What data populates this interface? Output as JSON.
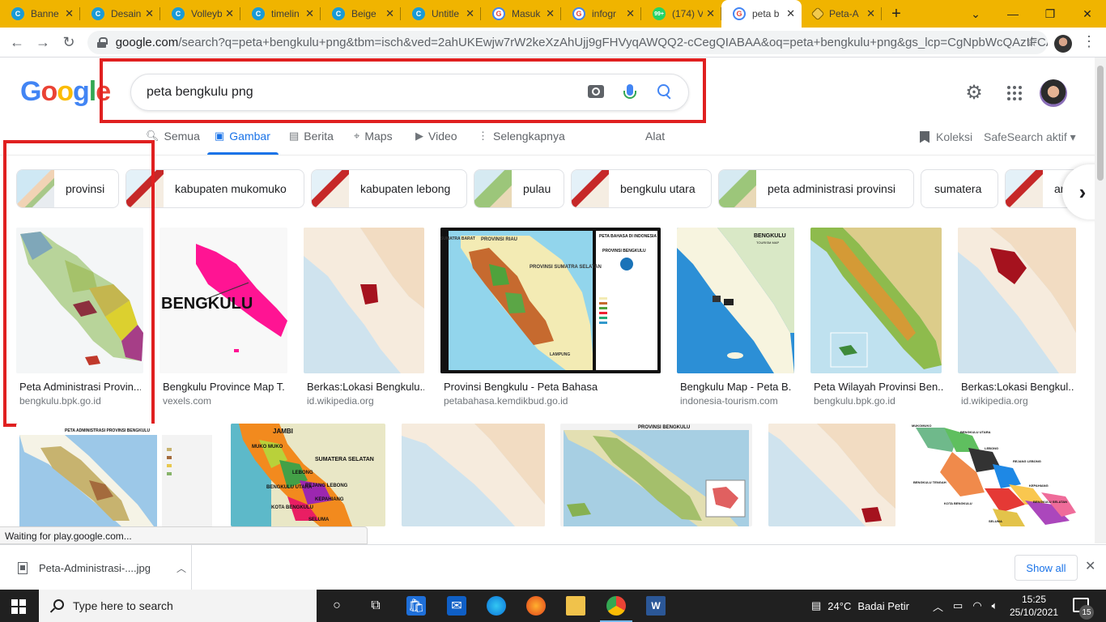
{
  "browser": {
    "tabs": [
      {
        "title": "Banne",
        "icon": "canva-icon"
      },
      {
        "title": "Desain",
        "icon": "canva-icon"
      },
      {
        "title": "Volleyb",
        "icon": "canva-icon"
      },
      {
        "title": "timelin",
        "icon": "canva-icon"
      },
      {
        "title": "Beige",
        "icon": "canva-icon"
      },
      {
        "title": "Untitle",
        "icon": "canva-icon"
      },
      {
        "title": "Masuk",
        "icon": "google-icon"
      },
      {
        "title": "infogr",
        "icon": "google-icon"
      },
      {
        "title": "(174) V",
        "icon": "whatsapp-icon"
      },
      {
        "title": "peta b",
        "icon": "google-icon",
        "active": true
      },
      {
        "title": "Peta-A",
        "icon": "map-icon"
      }
    ],
    "url_host": "google.com",
    "url_rest": "/search?q=peta+bengkulu+png&tbm=isch&ved=2ahUKEwjw7rW2keXzAhUjj9gFHVyqAWQQ2-cCegQIABAA&oq=peta+bengkulu+png&gs_lcp=CgNpbWcQAzIFCAA..."
  },
  "google": {
    "logo": [
      "G",
      "o",
      "o",
      "g",
      "l",
      "e"
    ],
    "query": "peta bengkulu png",
    "tabs": {
      "semua": "Semua",
      "gambar": "Gambar",
      "berita": "Berita",
      "maps": "Maps",
      "video": "Video",
      "selengkapnya": "Selengkapnya",
      "alat": "Alat",
      "koleksi": "Koleksi",
      "safesearch": "SafeSearch aktif"
    },
    "chips": [
      "provinsi",
      "kabupaten mukomuko",
      "kabupaten lebong",
      "pulau",
      "bengkulu utara",
      "peta administrasi provinsi",
      "sumatera",
      "an"
    ],
    "results": [
      {
        "title": "Peta Administrasi Provin...",
        "site": "bengkulu.bpk.go.id"
      },
      {
        "title": "Bengkulu Province Map T...",
        "site": "vexels.com",
        "image_text": "BENGKULU"
      },
      {
        "title": "Berkas:Lokasi Bengkulu...",
        "site": "id.wikipedia.org"
      },
      {
        "title": "Provinsi Bengkulu - Peta Bahasa",
        "site": "petabahasa.kemdikbud.go.id",
        "image_text_1": "PROVINSI RIAU",
        "image_text_2": "PROVINSI SUMATRA SELATAN",
        "image_text_3": "PETA BAHASA DI INDONESIA",
        "image_text_4": "PROVINSI BENGKULU",
        "image_text_5": "SUMATRA BARAT",
        "image_text_6": "LAMPUNG"
      },
      {
        "title": "Bengkulu Map - Peta B...",
        "site": "indonesia-tourism.com",
        "image_text": "BENGKULU",
        "image_text_2": "TOURISM MAP"
      },
      {
        "title": "Peta Wilayah Provinsi Ben...",
        "site": "bengkulu.bpk.go.id"
      },
      {
        "title": "Berkas:Lokasi Bengkul...",
        "site": "id.wikipedia.org"
      }
    ],
    "row2": {
      "map1_title": "PETA ADMINISTRASI PROVINSI BENGKULU",
      "map2_labels": [
        "JAMBI",
        "MUKO MUKO",
        "SUMATERA SELATAN",
        "LEBONG",
        "BENGKULU UTARA",
        "REJANG LEBONG",
        "KEPAHIANG",
        "KOTA BENGKULU",
        "SELUMA"
      ],
      "map4_title": "PROVINSI BENGKULU",
      "map6_labels": [
        "MUKOMUKO",
        "BENGKULU UTARA",
        "LEBONG",
        "REJANG LEBONG",
        "BENGKULU TENGAH",
        "KOTA BENGKULU",
        "KEPAHIANG",
        "SELUMA",
        "BENGKULU SELATAN"
      ]
    }
  },
  "status_text": "Waiting for play.google.com...",
  "download": {
    "filename": "Peta-Administrasi-....jpg",
    "show_all": "Show all"
  },
  "taskbar": {
    "search_placeholder": "Type here to search",
    "temperature": "24°C",
    "weather": "Badai Petir",
    "time": "15:25",
    "date": "25/10/2021",
    "notification_count": "15"
  }
}
